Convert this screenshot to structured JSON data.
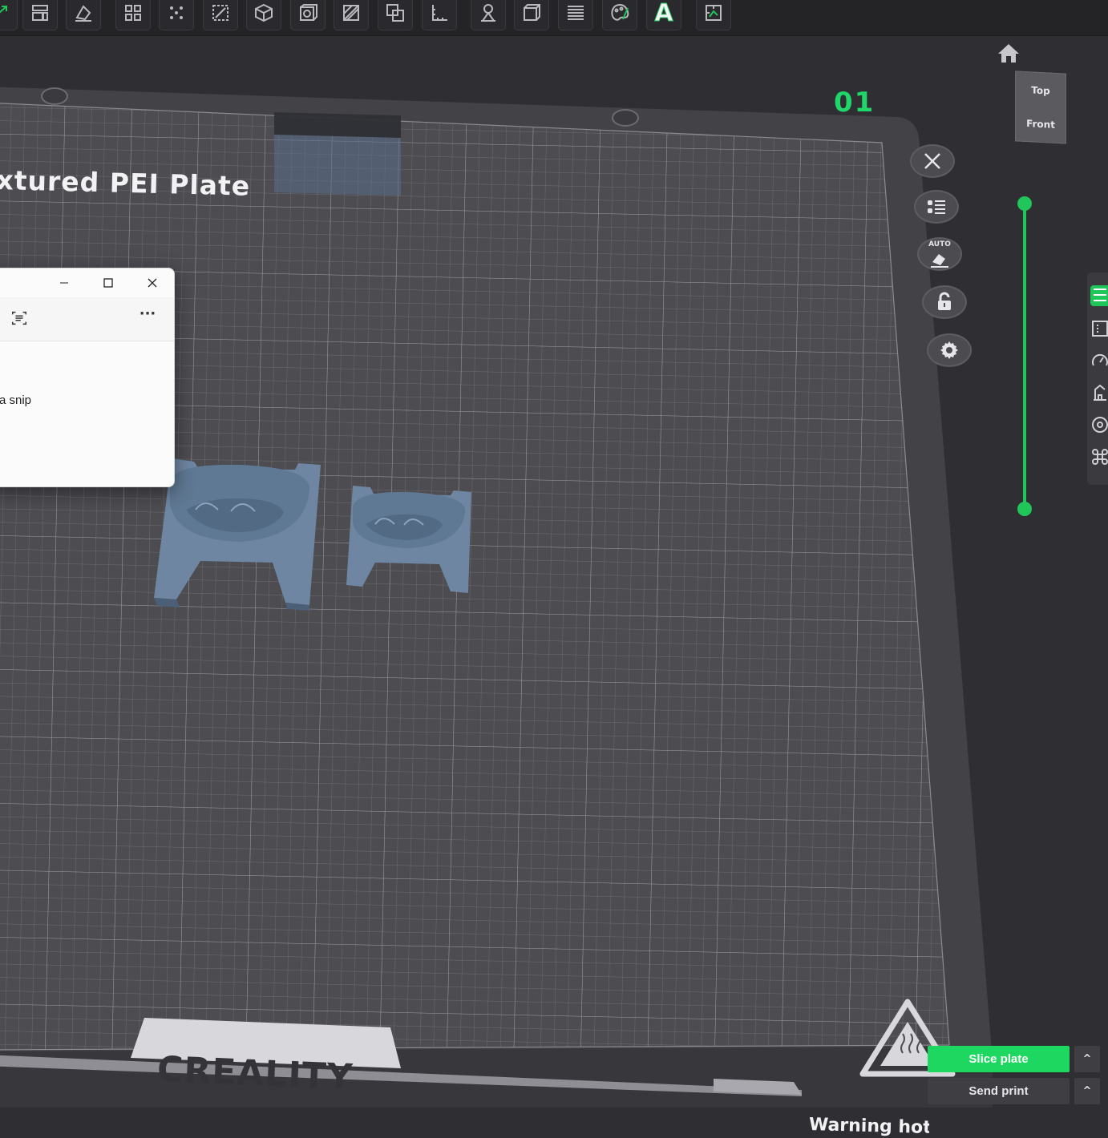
{
  "toolbar": {
    "tools": [
      {
        "name": "move",
        "icon": "move-icon"
      },
      {
        "name": "arrange",
        "icon": "arrange-icon"
      },
      {
        "name": "lay-on-face",
        "icon": "lay-on-face-icon"
      },
      {
        "name": "auto-arrange",
        "icon": "grid-arrange-icon"
      },
      {
        "name": "arrange-all",
        "icon": "dots-arrange-icon"
      },
      {
        "name": "scale",
        "icon": "scale-icon"
      },
      {
        "name": "cut",
        "icon": "cube-icon"
      },
      {
        "name": "hollow",
        "icon": "hollow-icon"
      },
      {
        "name": "support-paint",
        "icon": "hatch-icon"
      },
      {
        "name": "boolean",
        "icon": "boolean-icon"
      },
      {
        "name": "measure",
        "icon": "measure-icon"
      },
      {
        "name": "supports",
        "icon": "support-tree-icon"
      },
      {
        "name": "seam",
        "icon": "box-icon"
      },
      {
        "name": "layers",
        "icon": "layers-icon"
      },
      {
        "name": "color-paint",
        "icon": "palette-icon"
      },
      {
        "name": "text",
        "icon": "text-icon",
        "label": "A"
      },
      {
        "name": "assemble",
        "icon": "puzzle-icon"
      }
    ]
  },
  "viewport": {
    "plate_label": "xtured PEI Plate",
    "plate_number": "01",
    "brand": "CREALITY",
    "warning_text": "Warning hot s",
    "view_cube": {
      "top": "Top",
      "front": "Front"
    },
    "auto_label": "AUTO"
  },
  "snipping_tool": {
    "body_text": "a snip"
  },
  "actions": {
    "slice_label": "Slice plate",
    "send_label": "Send print",
    "caret": "^"
  },
  "colors": {
    "accent": "#20c65a",
    "slice_button": "#1ed760",
    "model": "#6e86a2",
    "plate": "#4f4f54",
    "background": "#2f2f33"
  }
}
